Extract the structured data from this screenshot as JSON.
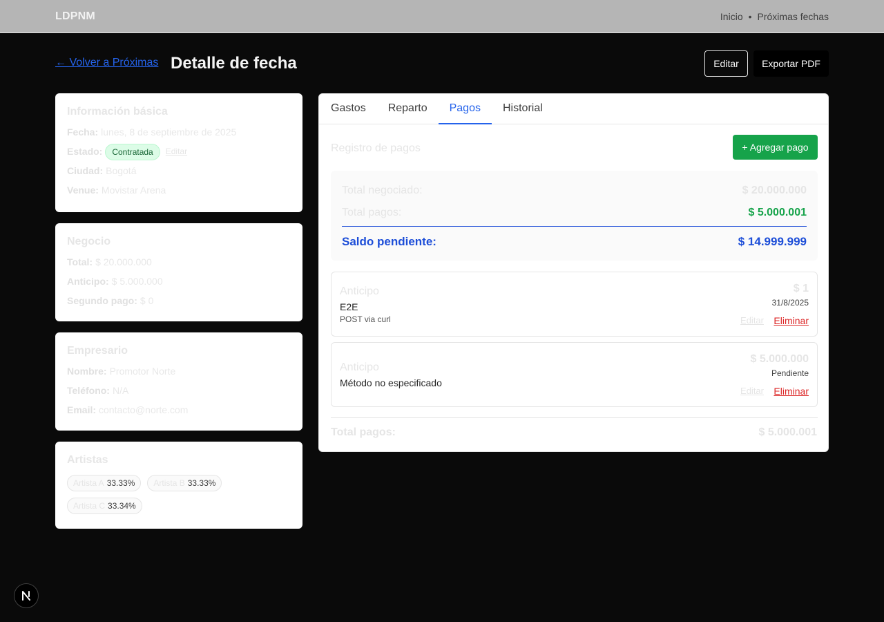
{
  "header": {
    "brand": "LDPNM",
    "nav": [
      "Inicio",
      "•",
      "Próximas fechas"
    ]
  },
  "page": {
    "back_link": "← Volver a Próximas",
    "title": "Detalle de fecha",
    "edit_button": "Editar",
    "export_button": "Exportar PDF"
  },
  "basic_info": {
    "title": "Información básica",
    "fecha_label": "Fecha:",
    "fecha_value": "lunes, 8 de septiembre de 2025",
    "estado_label": "Estado:",
    "estado_value": "Contratada",
    "estado_edit": "Editar",
    "ciudad_label": "Ciudad:",
    "ciudad_value": "Bogotá",
    "venue_label": "Venue:",
    "venue_value": "Movistar Arena"
  },
  "negocio": {
    "title": "Negocio",
    "total_label": "Total:",
    "total_value": "$ 20.000.000",
    "anticipo_label": "Anticipo:",
    "anticipo_value": "$ 5.000.000",
    "segundo_label": "Segundo pago:",
    "segundo_value": "$ 0"
  },
  "empresario": {
    "title": "Empresario",
    "nombre_label": "Nombre:",
    "nombre_value": "Promotor Norte",
    "telefono_label": "Teléfono:",
    "telefono_value": "N/A",
    "email_label": "Email:",
    "email_value": "contacto@norte.com"
  },
  "artistas": {
    "title": "Artistas",
    "items": [
      {
        "name": "Artista A",
        "pct": "33.33%"
      },
      {
        "name": "Artista B",
        "pct": "33.33%"
      },
      {
        "name": "Artista C",
        "pct": "33.34%"
      }
    ]
  },
  "tabs": [
    "Gastos",
    "Reparto",
    "Pagos",
    "Historial"
  ],
  "active_tab": "Pagos",
  "pagos": {
    "title": "Registro de pagos",
    "add_button": "+ Agregar pago",
    "summary": {
      "negociado_label": "Total negociado:",
      "negociado_value": "$ 20.000.000",
      "pagos_label": "Total pagos:",
      "pagos_value": "$ 5.000.001",
      "saldo_label": "Saldo pendiente:",
      "saldo_value": "$ 14.999.999"
    },
    "items": [
      {
        "type": "Anticipo",
        "desc": "E2E",
        "note": "POST via curl",
        "amount": "$ 1",
        "date": "31/8/2025",
        "edit": "Editar",
        "delete": "Eliminar"
      },
      {
        "type": "Anticipo",
        "desc": "Método no especificado",
        "note": "",
        "amount": "$ 5.000.000",
        "date": "Pendiente",
        "edit": "Editar",
        "delete": "Eliminar"
      }
    ],
    "total_label": "Total pagos:",
    "total_value": "$ 5.000.001"
  },
  "colors": {
    "accent": "#2563eb",
    "success": "#16a34a",
    "danger": "#dc2626",
    "background": "#0a0a0a"
  },
  "icons": {
    "next_badge": "nextjs-logo-icon"
  }
}
